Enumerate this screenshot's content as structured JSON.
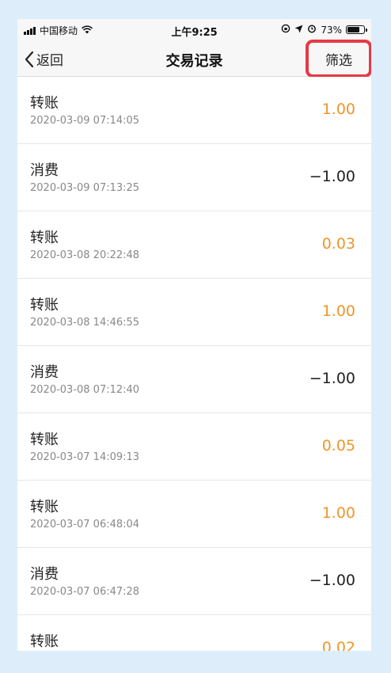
{
  "status_bar": {
    "carrier": "中国移动",
    "time": "上午9:25",
    "battery": "73%"
  },
  "nav": {
    "back_label": "返回",
    "title": "交易记录",
    "filter_label": "筛选"
  },
  "colors": {
    "positive": "#f0952a",
    "negative": "#222222",
    "highlight": "#e63946"
  },
  "transactions": [
    {
      "name": "转账",
      "date": "2020-03-09 07:14:05",
      "amount": "1.00",
      "kind": "pos"
    },
    {
      "name": "消费",
      "date": "2020-03-09 07:13:25",
      "amount": "−1.00",
      "kind": "neg"
    },
    {
      "name": "转账",
      "date": "2020-03-08 20:22:48",
      "amount": "0.03",
      "kind": "pos"
    },
    {
      "name": "转账",
      "date": "2020-03-08 14:46:55",
      "amount": "1.00",
      "kind": "pos"
    },
    {
      "name": "消费",
      "date": "2020-03-08 07:12:40",
      "amount": "−1.00",
      "kind": "neg"
    },
    {
      "name": "转账",
      "date": "2020-03-07 14:09:13",
      "amount": "0.05",
      "kind": "pos"
    },
    {
      "name": "转账",
      "date": "2020-03-07 06:48:04",
      "amount": "1.00",
      "kind": "pos"
    },
    {
      "name": "消费",
      "date": "2020-03-07 06:47:28",
      "amount": "−1.00",
      "kind": "neg"
    },
    {
      "name": "转账",
      "date": "",
      "amount": "0.02",
      "kind": "pos"
    }
  ]
}
